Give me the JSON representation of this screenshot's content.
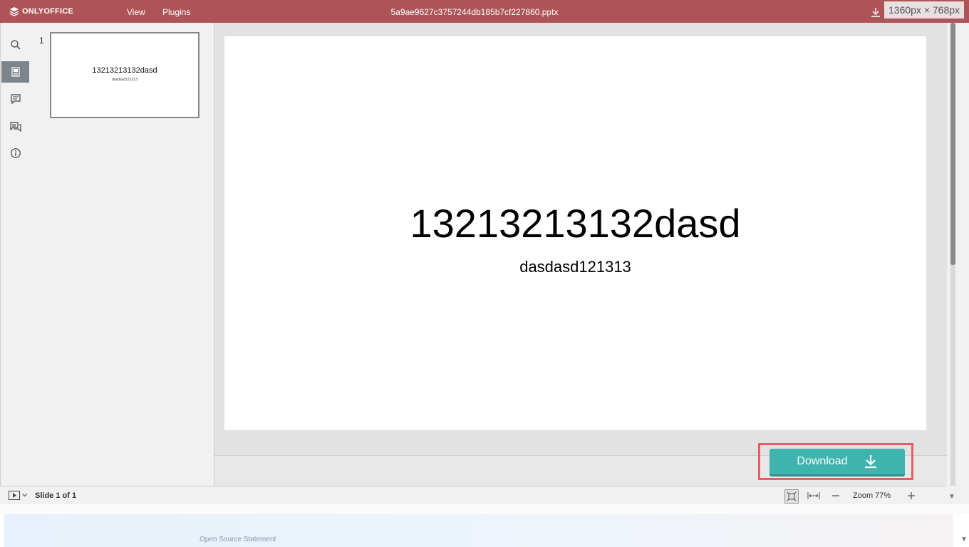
{
  "header": {
    "logo_text": "ONLYOFFICE",
    "menu": [
      "View",
      "Plugins"
    ],
    "doc_title": "5a9ae9627c3757244db185b7cf227860.pptx",
    "dims_badge": "1360px × 768px",
    "background": "#ae5457"
  },
  "rail": {
    "items": [
      {
        "icon": "search-icon",
        "active": false
      },
      {
        "icon": "slides-icon",
        "active": true
      },
      {
        "icon": "comments-icon",
        "active": false
      },
      {
        "icon": "chat-icon",
        "active": false
      },
      {
        "icon": "info-icon",
        "active": false
      }
    ]
  },
  "thumbnails": [
    {
      "number": "1",
      "title": "13213213132dasd",
      "subtitle": "dasdasd121313"
    }
  ],
  "slide": {
    "title": "13213213132dasd",
    "subtitle": "dasdasd121313"
  },
  "download": {
    "label": "Download",
    "color": "#3fb3ad",
    "highlight_color": "#e85d64"
  },
  "status": {
    "slide_count": "Slide 1 of 1",
    "zoom_label": "Zoom 77%"
  },
  "footer": {
    "link": "Open Source Statement"
  }
}
